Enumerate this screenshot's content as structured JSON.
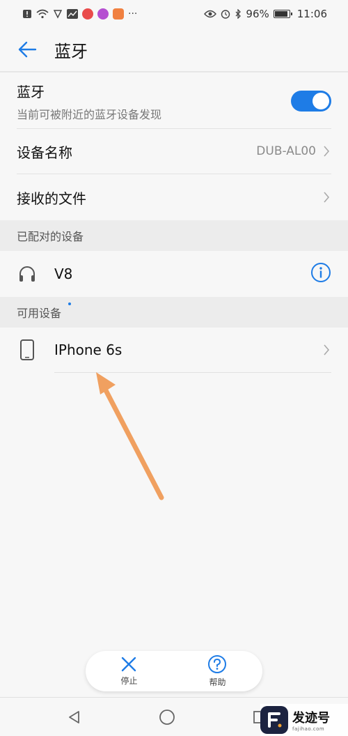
{
  "status_bar": {
    "battery_text": "96%",
    "battery_level": 0.96,
    "time": "11:06",
    "left_icons": [
      "alert-icon",
      "wifi-icon",
      "shield-icon",
      "chart-app-icon",
      "red-app-icon",
      "purple-app-icon",
      "orange-app-icon",
      "more-icon"
    ],
    "more_text": "···"
  },
  "header": {
    "title": "蓝牙"
  },
  "bluetooth": {
    "title": "蓝牙",
    "subtitle": "当前可被附近的蓝牙设备发现",
    "enabled": true
  },
  "device_name": {
    "label": "设备名称",
    "value": "DUB-AL00"
  },
  "received_files": {
    "label": "接收的文件"
  },
  "paired_section": {
    "title": "已配对的设备"
  },
  "paired_devices": [
    {
      "name": "V8",
      "icon": "headphones-icon"
    }
  ],
  "available_section": {
    "title": "可用设备"
  },
  "available_devices": [
    {
      "name": "IPhone 6s",
      "icon": "phone-icon"
    }
  ],
  "bottom_actions": {
    "stop_label": "停止",
    "help_label": "帮助"
  },
  "watermark": {
    "name": "发迹号",
    "url": "fajihao.com"
  },
  "colors": {
    "accent": "#1e7ce6",
    "arrow": "#f0a060"
  }
}
